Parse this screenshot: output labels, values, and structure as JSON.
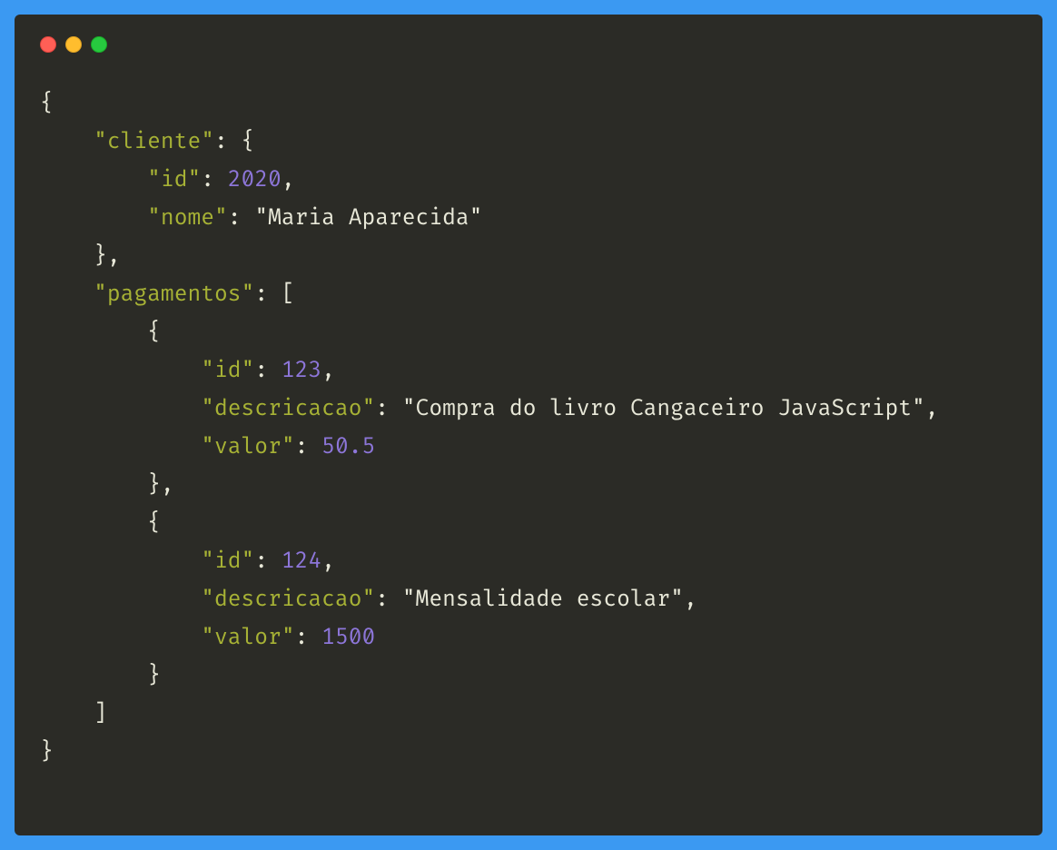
{
  "colors": {
    "frame_bg": "#3b99f2",
    "window_bg": "#2b2b26",
    "traffic_close": "#ff5f56",
    "traffic_min": "#ffbd2e",
    "traffic_max": "#27c93f",
    "punctuation": "#e8e8d8",
    "json_key": "#a7b235",
    "json_string": "#e8e8d8",
    "json_number": "#8d76d9"
  },
  "indent": "    ",
  "code": {
    "l1": "{",
    "l2_key": "\"cliente\"",
    "l2_after": ": {",
    "l3_key": "\"id\"",
    "l3_after": ": ",
    "l3_val": "2020",
    "l3_end": ",",
    "l4_key": "\"nome\"",
    "l4_after": ": ",
    "l4_val": "\"Maria Aparecida\"",
    "l5": "},",
    "l6_key": "\"pagamentos\"",
    "l6_after": ": [",
    "l7": "{",
    "l8_key": "\"id\"",
    "l8_after": ": ",
    "l8_val": "123",
    "l8_end": ",",
    "l9_key": "\"descricacao\"",
    "l9_after": ": ",
    "l9_val": "\"Compra do livro Cangaceiro JavaScript\"",
    "l9_end": ",",
    "l10_key": "\"valor\"",
    "l10_after": ": ",
    "l10_val": "50.5",
    "l11": "},",
    "l12": "{",
    "l13_key": "\"id\"",
    "l13_after": ": ",
    "l13_val": "124",
    "l13_end": ",",
    "l14_key": "\"descricacao\"",
    "l14_after": ": ",
    "l14_val": "\"Mensalidade escolar\"",
    "l14_end": ",",
    "l15_key": "\"valor\"",
    "l15_after": ": ",
    "l15_val": "1500",
    "l16": "}",
    "l17": "]",
    "l18": "}"
  }
}
